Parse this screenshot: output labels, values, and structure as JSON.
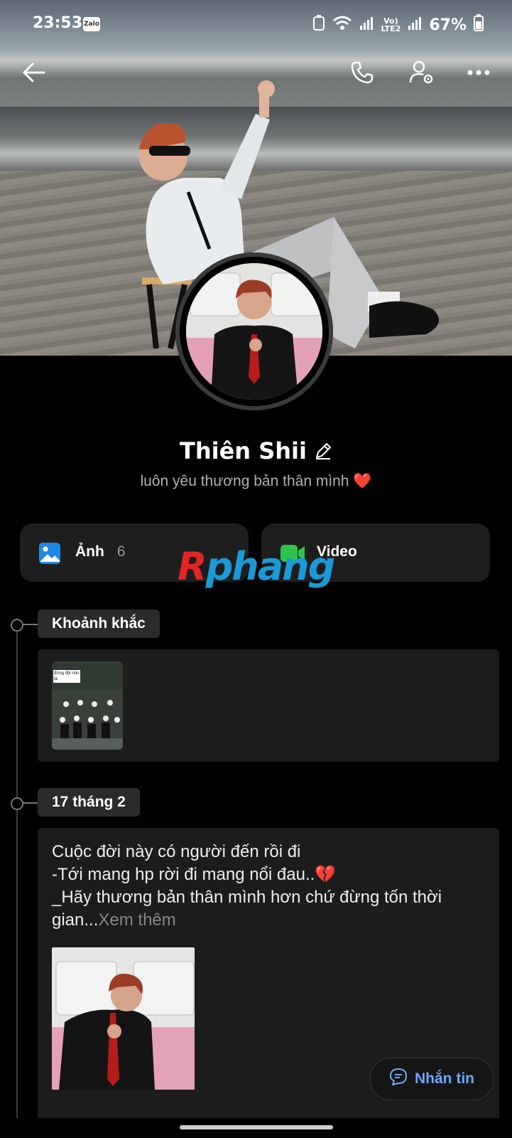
{
  "status_bar": {
    "time": "23:53",
    "app_badge": "Zalo",
    "network": "LTE2",
    "battery": "67%"
  },
  "profile": {
    "name": "Thiên Shii",
    "bio": "luôn yêu thương bản thân mình ❤️"
  },
  "tiles": [
    {
      "label": "Ảnh",
      "count": "6"
    },
    {
      "label": "Video",
      "count": ""
    }
  ],
  "watermark": {
    "r": "R",
    "rest": "phang"
  },
  "timeline": {
    "moments_label": "Khoảnh khắc",
    "moments_thumb_caption": "đừng đội nón lá",
    "date_label": "17 tháng 2",
    "post_lines": [
      "Cuộc đời này có người đến rồi đi",
      "-Tới mang hp rời đi mang nổi đau..💔",
      "_Hãy thương bản thân mình hơn chứ đừng tốn thời"
    ],
    "post_last_line": "gian...",
    "see_more": "Xem thêm"
  },
  "message_button": {
    "label": "Nhắn tin"
  },
  "colors": {
    "accent_blue": "#6ea8ff",
    "photo_icon": "#1e88e5",
    "video_icon": "#2ec44a"
  }
}
